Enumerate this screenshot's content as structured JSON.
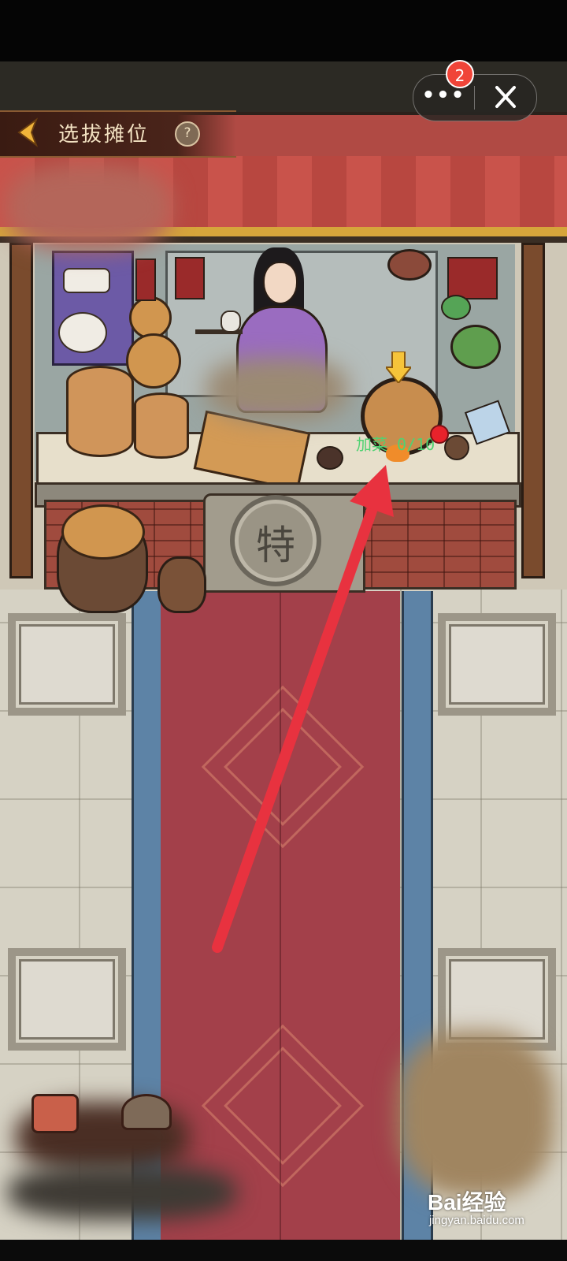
{
  "header": {
    "title": "选拔摊位",
    "help_symbol": "?"
  },
  "capsule": {
    "menu_label": "•••",
    "badge_count": "2"
  },
  "stall": {
    "emblem_char": "特"
  },
  "add_dish": {
    "label": "加菜 0/10",
    "current": 0,
    "max": 10
  },
  "watermark": {
    "brand": "Bai经验",
    "url": "jingyan.baidu.com"
  },
  "colors": {
    "accent": "#f04438",
    "arrow": "#e8323f",
    "label_green": "#50d272"
  }
}
